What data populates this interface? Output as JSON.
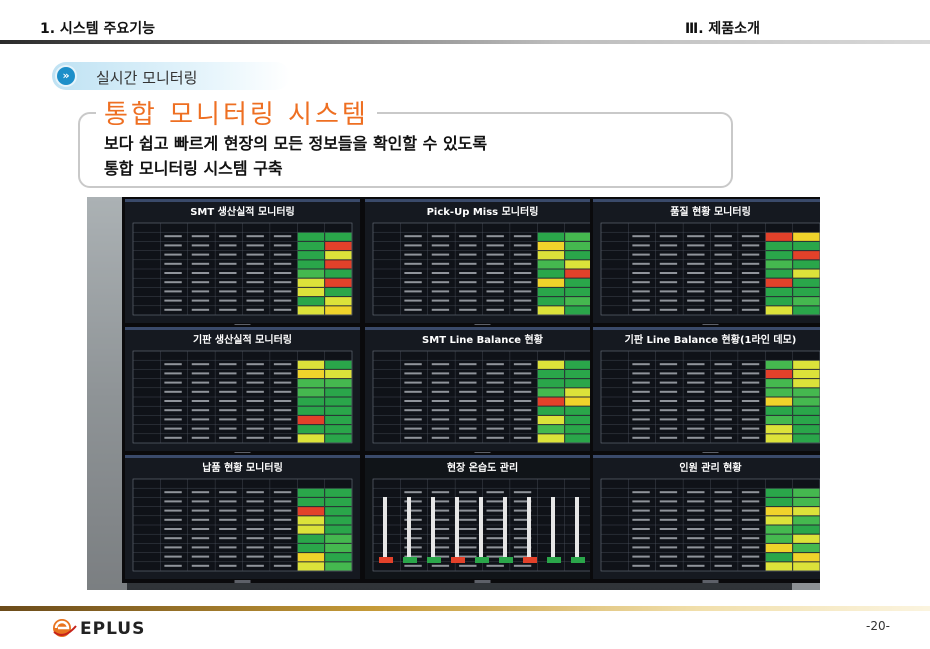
{
  "header": {
    "left_title": "1. 시스템 주요기능",
    "right_title": "Ⅲ. 제품소개"
  },
  "section": {
    "icon": "double-chevron-right-icon",
    "label": "실시간 모니터링"
  },
  "box": {
    "title": "통합 모니터링 시스템",
    "line1": "보다 쉽고 빠르게 현장의 모든 정보들을 확인할 수 있도록",
    "line2": "통합 모니터링 시스템 구축"
  },
  "photo": {
    "monitors": [
      "SMT 생산실적 모니터링",
      "Pick-Up Miss 모니터링",
      "품질 현황 모니터링",
      "기판 생산실적 모니터링",
      "SMT Line Balance 현황",
      "기판 Line Balance 현황(1라인 데모)",
      "납품 현황 모니터링",
      "현장 온습도 관리",
      "인원 관리 현황"
    ]
  },
  "footer": {
    "logo_text": "EPLUS",
    "page": "-20-"
  },
  "colors": {
    "accent": "#ee6f22",
    "section_icon": "#1d8fc9",
    "footer_gold": "#c59a38"
  }
}
